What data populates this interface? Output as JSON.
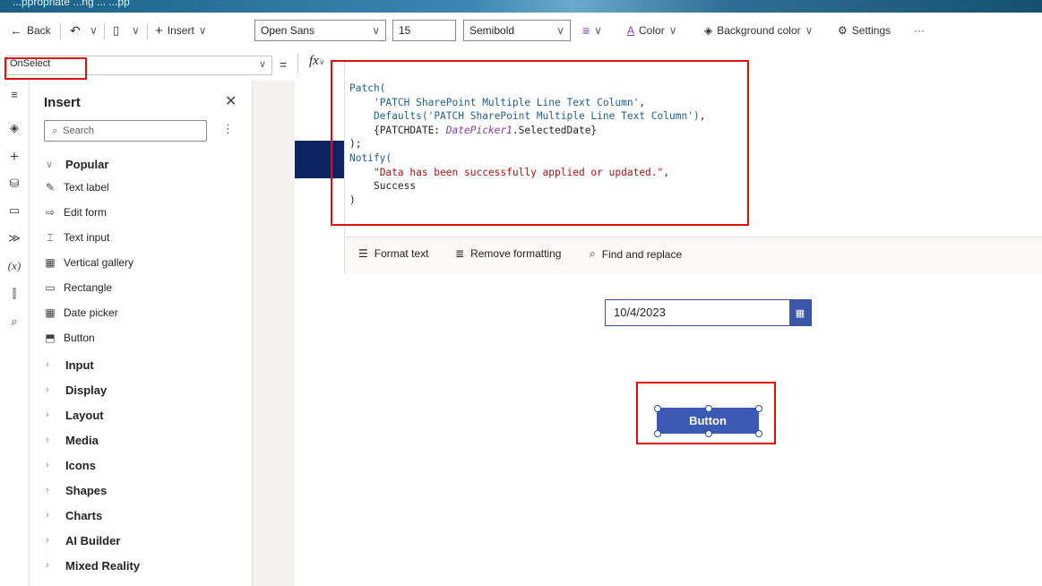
{
  "window": {
    "title": "...ppropriate ...ng ... ...pp"
  },
  "toolbar": {
    "back_label": "Back",
    "insert_label": "Insert",
    "font_family": "Open Sans",
    "font_size": "15",
    "font_weight": "Semibold",
    "color_label": "Color",
    "background_color_label": "Background color",
    "settings_label": "Settings",
    "more_label": "···"
  },
  "formula_bar": {
    "property": "OnSelect",
    "equals": "=",
    "fx_label": "fx"
  },
  "formula": {
    "lines": [
      {
        "t": [
          [
            "fn",
            "Patch("
          ]
        ]
      },
      {
        "t": [
          [
            "sp",
            "    "
          ],
          [
            "kw",
            "'PATCH SharePoint Multiple Line Text Column'"
          ],
          [
            "p",
            ","
          ]
        ]
      },
      {
        "t": [
          [
            "sp",
            "    "
          ],
          [
            "fn",
            "Defaults("
          ],
          [
            "kw",
            "'PATCH SharePoint Multiple Line Text Column'"
          ],
          [
            "fn",
            ")"
          ],
          [
            "p",
            ","
          ]
        ]
      },
      {
        "t": [
          [
            "sp",
            "    "
          ],
          [
            "p",
            "{PATCHDATE: "
          ],
          [
            "id",
            "DatePicker1"
          ],
          [
            "p",
            ".SelectedDate}"
          ]
        ]
      },
      {
        "t": [
          [
            "p",
            ");"
          ]
        ]
      },
      {
        "t": [
          [
            "fn",
            "Notify("
          ]
        ]
      },
      {
        "t": [
          [
            "sp",
            "    "
          ],
          [
            "str",
            "\"Data has been successfully applied or updated.\""
          ],
          [
            "p",
            ","
          ]
        ]
      },
      {
        "t": [
          [
            "sp",
            "    "
          ],
          [
            "p",
            "Success"
          ]
        ]
      },
      {
        "t": [
          [
            "p",
            ")"
          ]
        ]
      }
    ],
    "tools": {
      "format_text": "Format text",
      "remove_formatting": "Remove formatting",
      "find_replace": "Find and replace"
    }
  },
  "insert_pane": {
    "title": "Insert",
    "search_placeholder": "Search",
    "popular_label": "Popular",
    "popular_items": [
      {
        "label": "Text label",
        "icon": "text-label-icon",
        "glyph": "✎"
      },
      {
        "label": "Edit form",
        "icon": "edit-form-icon",
        "glyph": "⇨"
      },
      {
        "label": "Text input",
        "icon": "text-input-icon",
        "glyph": "⌶"
      },
      {
        "label": "Vertical gallery",
        "icon": "gallery-icon",
        "glyph": "▦"
      },
      {
        "label": "Rectangle",
        "icon": "rectangle-icon",
        "glyph": "▭"
      },
      {
        "label": "Date picker",
        "icon": "calendar-icon",
        "glyph": "▦"
      },
      {
        "label": "Button",
        "icon": "button-icon",
        "glyph": "⬒"
      }
    ],
    "categories": [
      "Input",
      "Display",
      "Layout",
      "Media",
      "Icons",
      "Shapes",
      "Charts",
      "AI Builder",
      "Mixed Reality"
    ]
  },
  "app": {
    "date_value": "10/4/2023",
    "button_label": "Button"
  },
  "colors": {
    "accent": "#3a5ab3",
    "highlight": "#e01010",
    "navy": "#0c2461"
  }
}
